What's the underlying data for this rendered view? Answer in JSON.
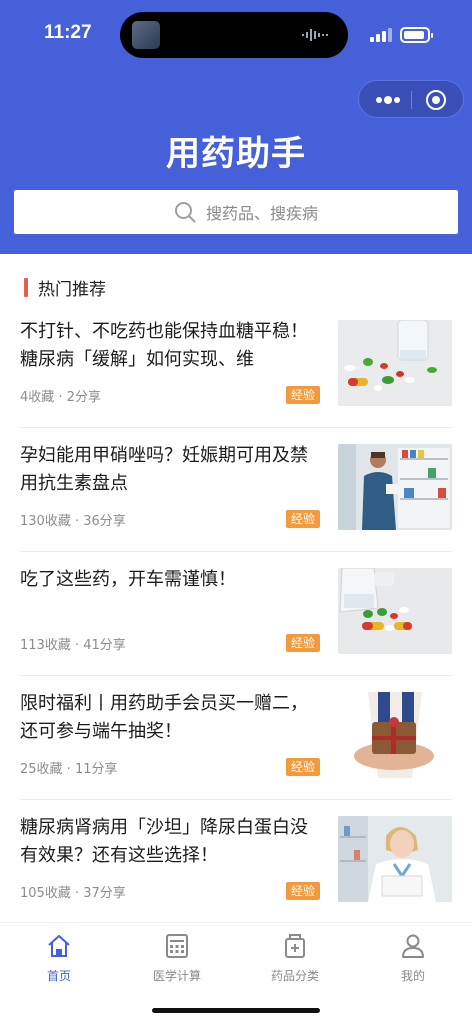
{
  "status_bar": {
    "time": "11:27"
  },
  "header": {
    "app_title": "用药助手",
    "search_placeholder": "搜药品、搜疾病"
  },
  "section": {
    "title": "热门推荐"
  },
  "articles": [
    {
      "title": "不打针、不吃药也能保持血糖平稳！糖尿病「缓解」如何实现、维",
      "meta": "4收藏 · 2分享",
      "tag": "经验",
      "thumb": "pills-scattered-image"
    },
    {
      "title": "孕妇能用甲硝唑吗？妊娠期可用及禁用抗生素盘点",
      "meta": "130收藏 · 36分享",
      "tag": "经验",
      "thumb": "pharmacist-shelf-image"
    },
    {
      "title": "吃了这些药，开车需谨慎！",
      "meta": "113收藏 · 41分享",
      "tag": "经验",
      "thumb": "pills-bottle-image"
    },
    {
      "title": "限时福利丨用药助手会员买一赠二，还可参与端午抽奖！",
      "meta": "25收藏 · 11分享",
      "tag": "经验",
      "thumb": "gift-box-image"
    },
    {
      "title": "糖尿病肾病用「沙坦」降尿白蛋白没有效果？还有这些选择！",
      "meta": "105收藏 · 37分享",
      "tag": "经验",
      "thumb": "nurse-image"
    }
  ],
  "tabbar": [
    {
      "label": "首页",
      "icon": "home-icon",
      "active": true
    },
    {
      "label": "医学计算",
      "icon": "calculator-icon",
      "active": false
    },
    {
      "label": "药品分类",
      "icon": "medicine-box-icon",
      "active": false
    },
    {
      "label": "我的",
      "icon": "user-icon",
      "active": false
    }
  ],
  "colors": {
    "primary": "#4560d8",
    "tag": "#f29a3e",
    "section_bar": "#e4604f"
  }
}
